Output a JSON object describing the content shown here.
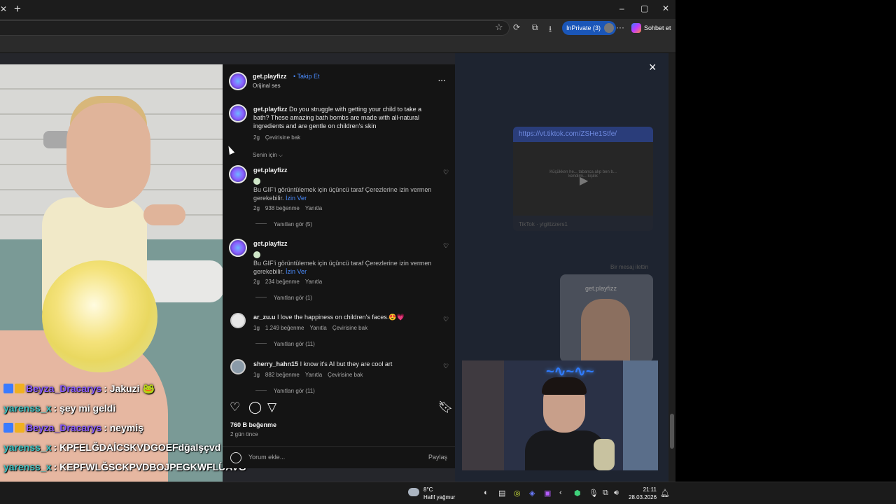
{
  "browser": {
    "inprivate_label": "InPrivate (3)",
    "copilot_label": "Sohbet et",
    "close_glyph": "×",
    "new_tab_glyph": "+",
    "minimize_glyph": "–",
    "maximize_glyph": "▢",
    "window_close_glyph": "✕"
  },
  "post": {
    "username": "get.playfizz",
    "follow_label": "Takip Et",
    "audio": "Orijinal ses",
    "more_glyph": "···",
    "caption_user": "get.playfizz",
    "caption": "Do you struggle with getting your child to take a bath? These amazing bath bombs are made with all-natural ingredients and are gentle on children's skin",
    "caption_time": "2g",
    "caption_translate": "Çevirisine bak",
    "sort_label": "Senin için ⌵",
    "likes": "760 B beğenme",
    "posted_ago": "2 gün önce",
    "comment_placeholder": "Yorum ekle...",
    "share_label": "Paylaş"
  },
  "comments": [
    {
      "user": "get.playfizz",
      "text": "Bu GIF'i görüntülemek için üçüncü taraf Çerezlerine izin vermen gerekebilir.",
      "allow": "İzin Ver",
      "time": "2g",
      "likes": "938 beğenme",
      "reply": "Yanıtla",
      "view_replies": "Yanıtları gör (5)"
    },
    {
      "user": "get.playfizz",
      "text": "Bu GIF'i görüntülemek için üçüncü taraf Çerezlerine izin vermen gerekebilir.",
      "allow": "İzin Ver",
      "time": "2g",
      "likes": "234 beğenme",
      "reply": "Yanıtla",
      "view_replies": "Yanıtları gör (1)"
    },
    {
      "user": "ar_zu.u",
      "text": "I love the happiness on children's faces.😍💗",
      "time": "1g",
      "likes": "1.249 beğenme",
      "reply": "Yanıtla",
      "translate": "Çevirisine bak",
      "view_replies": "Yanıtları gör (11)"
    },
    {
      "user": "sherry_hahn15",
      "text": "I know it's AI but they are cool art",
      "time": "1g",
      "likes": "882 beğenme",
      "reply": "Yanıtla",
      "translate": "Çevirisine bak",
      "view_replies": "Yanıtları gör (11)"
    }
  ],
  "dm": {
    "link": "https://vt.tiktok.com/ZSHe1Stfe/",
    "tiktok_label": "TikTok · yigittzzers1",
    "preview_text": "Küçükken he... tabanca alıp ben b... kendimi... kişilik",
    "forwarded_label": "Bir mesaj ilettin",
    "forwarded_user": "get.playfizz"
  },
  "stream_chat": [
    {
      "user": "Beyza_Dracarys",
      "msg": ": Jakuzi 🐸",
      "color": "#8a5cff",
      "badges": true
    },
    {
      "user": "yarenss_x",
      "msg": ": şey mi geldi",
      "color": "#3fc4c4",
      "badges": false
    },
    {
      "user": "Beyza_Dracarys",
      "msg": ": neymiş",
      "color": "#8a5cff",
      "badges": true
    },
    {
      "user": "yarenss_x",
      "msg": ": KPFELĞDAİCSKVDGOEFdğalşçvd",
      "color": "#3fc4c4",
      "badges": false
    },
    {
      "user": "yarenss_x",
      "msg": ": KEPFWLĞSCKPVDBOJPEGKWFLÜAVĞ",
      "color": "#3fc4c4",
      "badges": false
    }
  ],
  "taskbar": {
    "temp": "8°C",
    "weather": "Hafif yağmur",
    "time": "21:11",
    "date": "28.03.2026"
  }
}
